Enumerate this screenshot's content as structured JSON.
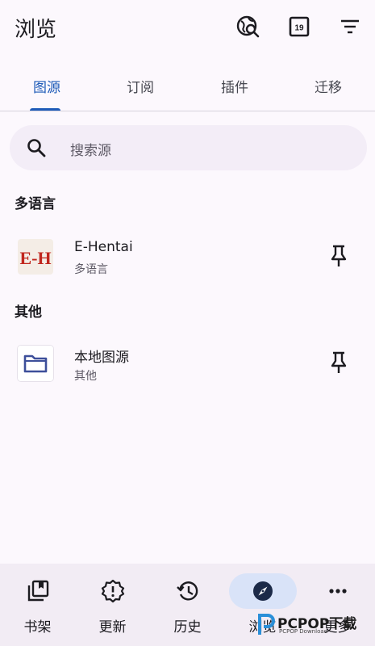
{
  "app": {
    "title": "浏览"
  },
  "toolbar": {
    "icons": [
      "global-search-icon",
      "calendar-19-icon",
      "filter-icon"
    ],
    "calendar_day": "19"
  },
  "tabs": [
    {
      "label": "图源",
      "active": true
    },
    {
      "label": "订阅",
      "active": false
    },
    {
      "label": "插件",
      "active": false
    },
    {
      "label": "迁移",
      "active": false
    }
  ],
  "search": {
    "placeholder": "搜索源"
  },
  "sections": [
    {
      "header": "多语言",
      "items": [
        {
          "title": "E-Hentai",
          "subtitle": "多语言",
          "logo_text": "E-H",
          "pinned_icon": "pin-icon"
        }
      ]
    },
    {
      "header": "其他",
      "items": [
        {
          "title": "本地图源",
          "subtitle": "其他",
          "icon": "folder-icon",
          "pinned_icon": "pin-icon"
        }
      ]
    }
  ],
  "bottom_nav": [
    {
      "label": "书架",
      "icon": "library-icon",
      "active": false
    },
    {
      "label": "更新",
      "icon": "alert-badge-icon",
      "active": false
    },
    {
      "label": "历史",
      "icon": "history-icon",
      "active": false
    },
    {
      "label": "浏览",
      "icon": "compass-icon",
      "active": true
    },
    {
      "label": "更多",
      "icon": "more-icon",
      "active": false
    }
  ],
  "watermark": {
    "text": "PCPOP下载",
    "subtext": "PCPOP Download"
  },
  "colors": {
    "accent": "#1e5bb8",
    "background": "#fcf8fd",
    "nav_background": "#f2ecf4",
    "active_pill": "#d9e3f8",
    "logo_red": "#c0261e"
  }
}
